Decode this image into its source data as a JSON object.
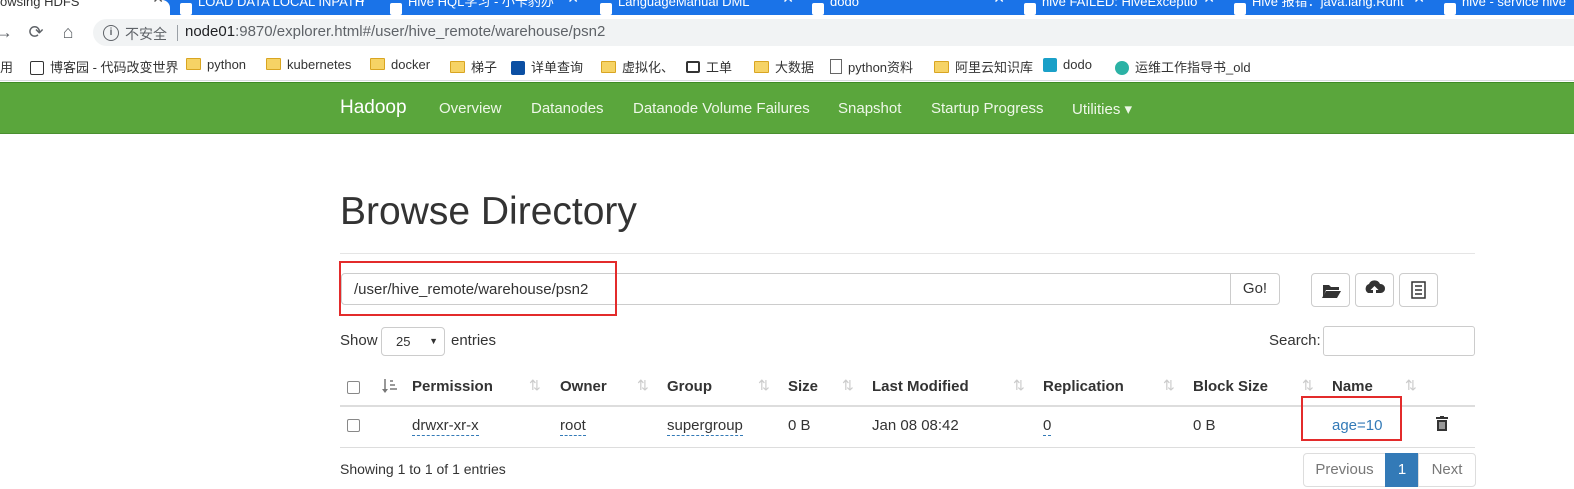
{
  "browser": {
    "tabs": [
      {
        "title": "owsing HDFS",
        "active": true
      },
      {
        "title": "LOAD DATA LOCAL INPATH"
      },
      {
        "title": "Hive HQL学习 - 小卡豹办"
      },
      {
        "title": "LanguageManual DML"
      },
      {
        "title": "dodo"
      },
      {
        "title": "hive FAILED: HiveExceptio"
      },
      {
        "title": "Hive 报错：java.lang.Runt"
      },
      {
        "title": "hive - service hive"
      }
    ],
    "address": {
      "security_label": "不安全",
      "host": "node01",
      "rest": ":9870/explorer.html#/user/hive_remote/warehouse/psn2"
    },
    "bookmarks": [
      {
        "label": "用",
        "icon": "apps"
      },
      {
        "label": "博客园 - 代码改变世界",
        "icon": "cnblogs"
      },
      {
        "label": "python",
        "icon": "folder"
      },
      {
        "label": "kubernetes",
        "icon": "folder"
      },
      {
        "label": "docker",
        "icon": "folder"
      },
      {
        "label": "梯子",
        "icon": "folder"
      },
      {
        "label": "详单查询",
        "icon": "telecom"
      },
      {
        "label": "虚拟化、",
        "icon": "folder"
      },
      {
        "label": "工单",
        "icon": "link"
      },
      {
        "label": "大数据",
        "icon": "folder"
      },
      {
        "label": "python资料",
        "icon": "doc"
      },
      {
        "label": "阿里云知识库",
        "icon": "folder"
      },
      {
        "label": "dodo",
        "icon": "dodo"
      },
      {
        "label": "运维工作指导书_old",
        "icon": "guide"
      }
    ]
  },
  "navbar": {
    "brand": "Hadoop",
    "links": [
      "Overview",
      "Datanodes",
      "Datanode Volume Failures",
      "Snapshot",
      "Startup Progress",
      "Utilities ▾"
    ]
  },
  "page": {
    "title": "Browse Directory",
    "path_value": "/user/hive_remote/warehouse/psn2",
    "go_label": "Go!",
    "icons": [
      "folder-open-icon",
      "upload-icon",
      "list-icon"
    ],
    "show_label": "Show",
    "page_size": "25",
    "entries_label": "entries",
    "search_label": "Search:"
  },
  "table": {
    "headers": [
      "Permission",
      "Owner",
      "Group",
      "Size",
      "Last Modified",
      "Replication",
      "Block Size",
      "Name"
    ],
    "rows": [
      {
        "permission": "drwxr-xr-x",
        "owner": "root",
        "group": "supergroup",
        "size": "0 B",
        "last_modified": "Jan 08 08:42",
        "replication": "0",
        "block_size": "0 B",
        "name": "age=10"
      }
    ],
    "summary": "Showing 1 to 1 of 1 entries"
  },
  "pagination": {
    "previous": "Previous",
    "current": "1",
    "next": "Next"
  },
  "colors": {
    "navbar": "#5aa63c",
    "link": "#337ab7",
    "highlight_box": "#e32b2b",
    "tabstrip": "#1a73e8"
  }
}
